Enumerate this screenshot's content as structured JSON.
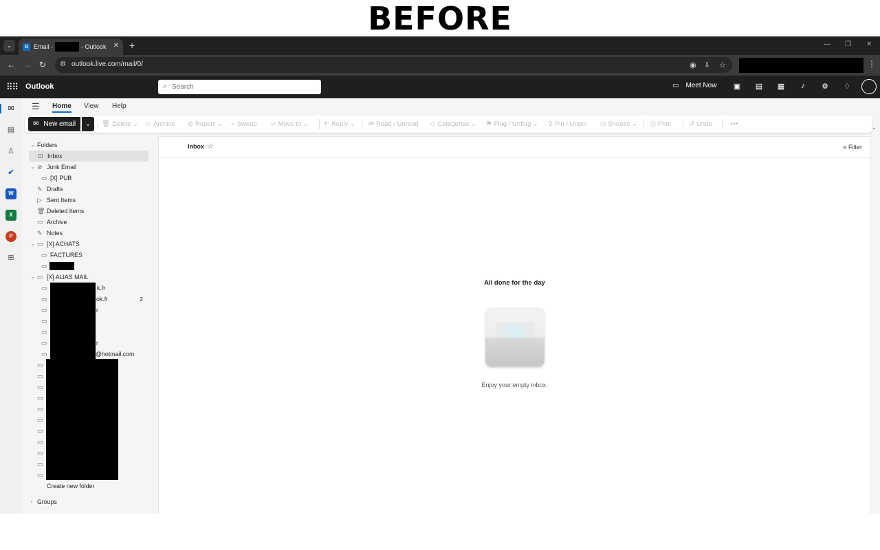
{
  "banner": {
    "text": "BEFORE"
  },
  "browser": {
    "tab_title_prefix": "Email -",
    "tab_title_suffix": "- Outlook",
    "favicon_letter": "O",
    "close_tab": "✕",
    "new_tab": "+",
    "url": "outlook.live.com/mail/0/"
  },
  "header": {
    "brand": "Outlook",
    "search_placeholder": "Search",
    "meet_now": "Meet Now"
  },
  "ribbon": {
    "tabs": [
      "Home",
      "View",
      "Help"
    ],
    "new_email": "New email",
    "buttons": {
      "delete": "Delete",
      "archive": "Archive",
      "report": "Report",
      "sweep": "Sweep",
      "move_to": "Move to",
      "reply": "Reply",
      "read_unread": "Read / Unread",
      "categorise": "Categorise",
      "flag_unflag": "Flag / Unflag",
      "pin_unpin": "Pin / Unpin",
      "snooze": "Snooze",
      "print": "Print",
      "undo": "Undo"
    },
    "more": "···"
  },
  "folders": {
    "header": "Folders",
    "items": {
      "inbox": "Inbox",
      "junk": "Junk Email",
      "pub": "[X] PUB",
      "drafts": "Drafts",
      "sent": "Sent Items",
      "deleted": "Deleted Items",
      "archive": "Archive",
      "notes": "Notes",
      "achats": "[X] ACHATS",
      "factures": "FACTURES",
      "alias": "[X] ALIAS MAIL",
      "alias1_tail": "k.fr",
      "alias2_tail": "ok.fr",
      "alias2_count": "2",
      "alias3_tail": "r",
      "alias6_tail": "r",
      "alias7_tail": "@hotmail.com"
    },
    "create_new": "Create new folder",
    "groups": "Groups"
  },
  "content": {
    "list_title": "Inbox",
    "filter": "Filter",
    "empty_title": "All done for the day",
    "empty_sub": "Enjoy your empty inbox."
  }
}
